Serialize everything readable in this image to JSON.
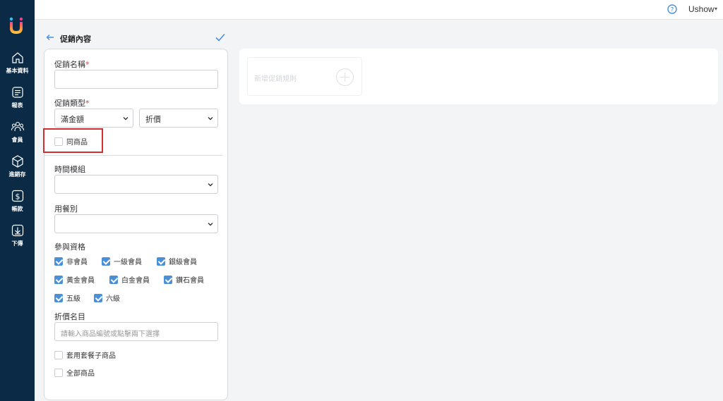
{
  "colors": {
    "sidebar": "#0b2a45",
    "accent": "#4a90d9",
    "highlight": "#d32f2f",
    "required": "#e53935"
  },
  "sidebar": {
    "logo": "logo-icon",
    "items": [
      {
        "label": "基本資料",
        "icon": "home-icon"
      },
      {
        "label": "報表",
        "icon": "report-icon"
      },
      {
        "label": "會員",
        "icon": "members-icon"
      },
      {
        "label": "進銷存",
        "icon": "inventory-box-icon"
      },
      {
        "label": "帳款",
        "icon": "dollar-icon"
      },
      {
        "label": "下傳",
        "icon": "download-icon"
      }
    ]
  },
  "topbar": {
    "user_name": "Ushow",
    "help_icon": "help-icon",
    "caret": "▾"
  },
  "page": {
    "title": "促銷內容",
    "back_icon": "back-arrow-icon",
    "confirm_icon": "check-icon"
  },
  "form": {
    "promo_name": {
      "label": "促銷名稱",
      "required_mark": "*",
      "value": "",
      "placeholder": ""
    },
    "promo_type": {
      "label": "促銷類型",
      "required_mark": "*",
      "type_value": "滿金額",
      "method_value": "折價"
    },
    "same_product": {
      "label": "同商品",
      "checked": false
    },
    "time_template": {
      "label": "時間模組",
      "value": ""
    },
    "meal_type": {
      "label": "用餐別",
      "value": ""
    },
    "eligibility": {
      "label": "參與資格",
      "options": [
        {
          "label": "非會員",
          "checked": true
        },
        {
          "label": "一級會員",
          "checked": true
        },
        {
          "label": "銀級會員",
          "checked": true
        },
        {
          "label": "黃金會員",
          "checked": true
        },
        {
          "label": "白金會員",
          "checked": true
        },
        {
          "label": "鑽石會員",
          "checked": true
        },
        {
          "label": "五級",
          "checked": true
        },
        {
          "label": "六級",
          "checked": true
        }
      ]
    },
    "discount_items": {
      "label": "折價名目",
      "placeholder": "請輸入商品編號或點擊兩下選擇"
    },
    "apply_combo": {
      "label": "套用套餐子商品",
      "checked": false
    },
    "all_products": {
      "label": "全部商品",
      "checked": false
    }
  },
  "rules": {
    "add_rule_text": "新增促銷規則",
    "add_icon": "plus-circle-icon"
  }
}
